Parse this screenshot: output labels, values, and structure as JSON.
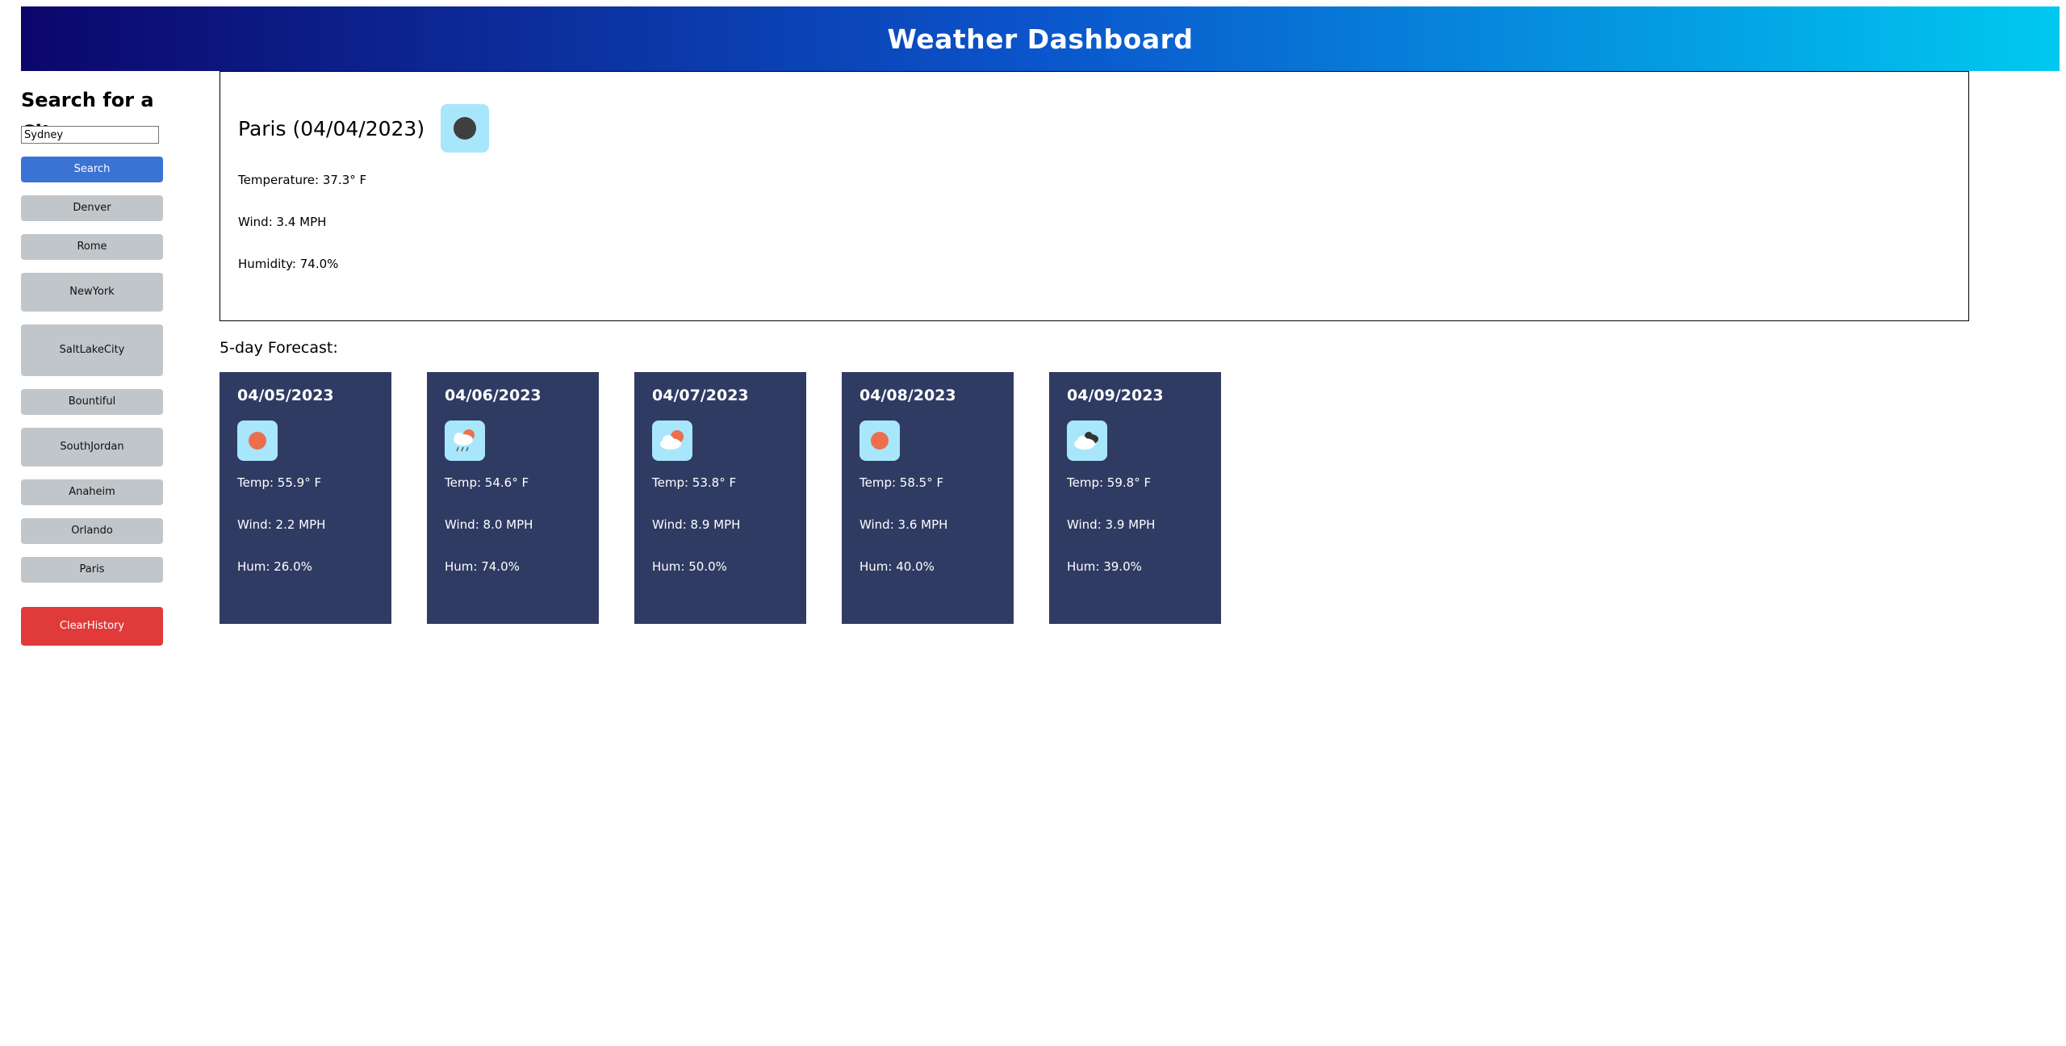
{
  "header": {
    "title": "Weather Dashboard"
  },
  "sidebar": {
    "heading": "Search for a City:",
    "search_value": "Sydney",
    "search_label": "Search",
    "history": [
      [
        "Denver"
      ],
      [
        "Rome"
      ],
      [
        "New",
        "York"
      ],
      [
        "Salt",
        "Lake",
        "City"
      ],
      [
        "Bountiful"
      ],
      [
        "South",
        "Jordan"
      ],
      [
        "Anaheim"
      ],
      [
        "Orlando"
      ],
      [
        "Paris"
      ]
    ],
    "clear_label": [
      "Clear",
      "History"
    ]
  },
  "current": {
    "title": "Paris (04/04/2023)",
    "icon": "dark-circle-icon",
    "temperature": "Temperature: 37.3° F",
    "wind": "Wind: 3.4 MPH",
    "humidity": "Humidity: 74.0%"
  },
  "forecast": {
    "title": "5-day Forecast:",
    "days": [
      {
        "date": "04/05/2023",
        "icon": "sun-icon",
        "temp": "Temp: 55.9° F",
        "wind": "Wind: 2.2 MPH",
        "hum": "Hum: 26.0%"
      },
      {
        "date": "04/06/2023",
        "icon": "rain-sun-icon",
        "temp": "Temp: 54.6° F",
        "wind": "Wind: 8.0 MPH",
        "hum": "Hum: 74.0%"
      },
      {
        "date": "04/07/2023",
        "icon": "partly-cloudy-icon",
        "temp": "Temp: 53.8° F",
        "wind": "Wind: 8.9 MPH",
        "hum": "Hum: 50.0%"
      },
      {
        "date": "04/08/2023",
        "icon": "sun-icon",
        "temp": "Temp: 58.5° F",
        "wind": "Wind: 3.6 MPH",
        "hum": "Hum: 40.0%"
      },
      {
        "date": "04/09/2023",
        "icon": "dark-clouds-icon",
        "temp": "Temp: 59.8° F",
        "wind": "Wind: 3.9 MPH",
        "hum": "Hum: 39.0%"
      }
    ]
  },
  "colors": {
    "header_start": "#0c066b",
    "header_end": "#00c9f0",
    "search_button": "#3a73d4",
    "history_button": "#c1c6ca",
    "clear_button": "#e13a3a",
    "card_bg": "#303b63",
    "icon_bg": "#a8e6fb",
    "sun": "#ec6e4c"
  }
}
